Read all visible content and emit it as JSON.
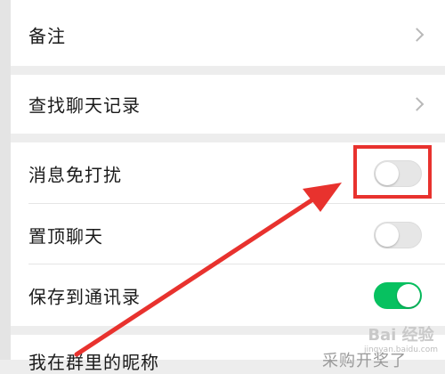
{
  "rows": {
    "remark": {
      "label": "备注"
    },
    "search_history": {
      "label": "查找聊天记录"
    },
    "do_not_disturb": {
      "label": "消息免打扰",
      "toggle_on": false
    },
    "pin_chat": {
      "label": "置顶聊天",
      "toggle_on": false
    },
    "save_to_contacts": {
      "label": "保存到通讯录",
      "toggle_on": true
    },
    "group_nickname": {
      "label": "我在群里的昵称",
      "value": "采购开奖了"
    }
  },
  "colors": {
    "toggle_on": "#07c160",
    "annotation": "#e8322e",
    "background": "#ededed"
  },
  "watermark": {
    "logo": "Bai 经验",
    "url": "jingyan.baidu.com"
  }
}
